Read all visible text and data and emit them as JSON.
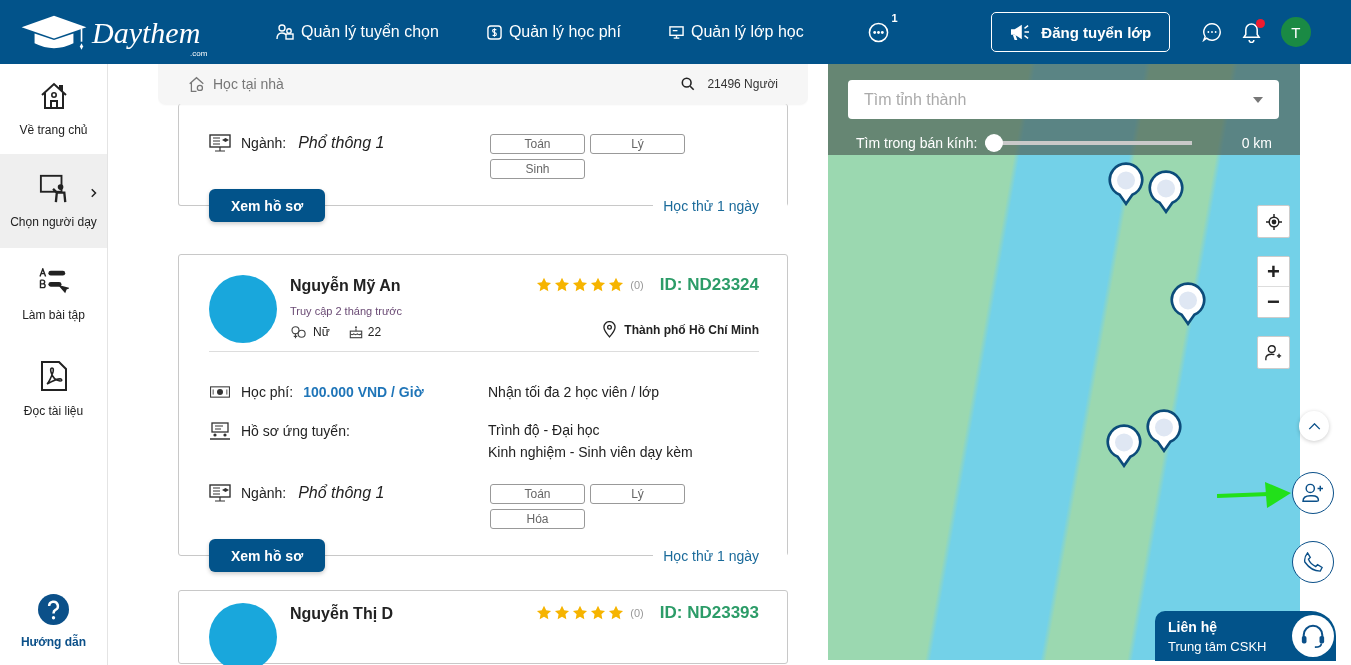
{
  "header": {
    "logo": {
      "name": "Daythem",
      "suffix": ".com"
    },
    "nav": [
      {
        "label": "Quản lý tuyển chọn",
        "kind": "people"
      },
      {
        "label": "Quản lý học phí",
        "kind": "money"
      },
      {
        "label": "Quản lý lớp học",
        "kind": "board"
      }
    ],
    "more": {
      "badge": "1"
    },
    "post_button": "Đăng tuyển lớp",
    "notification": {
      "unread": true
    },
    "avatar": "T"
  },
  "sidebar": {
    "items": [
      {
        "label": "Về trang chủ",
        "kind": "home",
        "selected": false
      },
      {
        "label": "Chọn người dạy",
        "kind": "teacher",
        "selected": true
      },
      {
        "label": "Làm bài tập",
        "kind": "exercise",
        "selected": false
      },
      {
        "label": "Đọc tài liệu",
        "kind": "pdf",
        "selected": false
      }
    ],
    "help": "Hướng dẫn"
  },
  "search_bar": {
    "placeholder": "Học tại nhà",
    "count": "21496 Người"
  },
  "cards": [
    {
      "kind": "tail",
      "major_label": "Ngành:",
      "major": "Phổ thông 1",
      "subjects": [
        "Toán",
        "Lý",
        "Sinh"
      ],
      "button": "Xem hồ sơ",
      "trial": "Học thử 1 ngày"
    },
    {
      "kind": "full",
      "name": "Nguyễn Mỹ An",
      "access": "Truy cập 2 tháng trước",
      "gender": "Nữ",
      "age": "22",
      "stars": 5,
      "rating_count": "(0)",
      "id": "ID: ND23324",
      "location": "Thành phố Hồ Chí Minh",
      "fee_label": "Học phí:",
      "fee": "100.000 VND / Giờ",
      "capacity": "Nhận tối đa 2 học viên / lớp",
      "profile_label": "Hồ sơ ứng tuyển:",
      "profile_lines": [
        "Trình độ - Đại học",
        "Kinh nghiệm - Sinh viên dạy kèm"
      ],
      "major_label": "Ngành:",
      "major": "Phổ thông 1",
      "subjects": [
        "Toán",
        "Lý",
        "Hóa"
      ],
      "button": "Xem hồ sơ",
      "trial": "Học thử 1 ngày"
    },
    {
      "kind": "head",
      "name": "Nguyễn Thị D",
      "stars": 5,
      "rating_count": "(0)",
      "id": "ID: ND23393"
    }
  ],
  "map": {
    "search_placeholder": "Tìm tỉnh thành",
    "radius_label": "Tìm trong bán kính:",
    "radius": {
      "level": 0
    },
    "radius_reading": "0 km",
    "zoom_in": "+",
    "zoom_out": "−"
  },
  "contact": {
    "title": "Liên hệ",
    "subtitle": "Trung tâm CSKH"
  }
}
